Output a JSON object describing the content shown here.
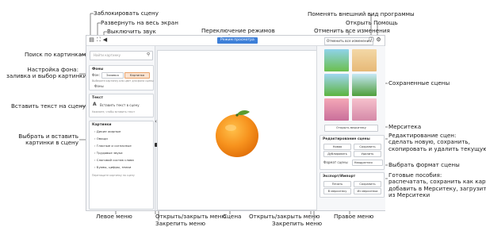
{
  "annotations": {
    "lock_scene": "Заблокировать сцену",
    "fullscreen": "Развернуть на весь экран",
    "mute": "Выключить звук",
    "mode_switch": "Переключение режимов",
    "change_look": "Поменять внешний вид программы",
    "open_help": "Открыть Помощь",
    "undo_all": "Отменить все изменения",
    "image_search": "Поиск по картинкам",
    "bg_setup": "Настройка фона:\nзаливка и выбор картинки",
    "insert_text": "Вставить текст на сцену",
    "insert_images": "Выбрать и вставить\nкартинки в сцену",
    "saved_scenes": "Сохраненные сцены",
    "merstika": "Мерситека",
    "edit_scenes": "Редактирование сцен:\nсделать новую, сохранить,\nскопировать и удалить текущую сцену",
    "scene_format": "Выбрать формат сцены",
    "ready_tools": "Готовые пособия:\nраспечатать, сохранить как картинку,\nдобавить в Мерситеку, загрузить\nиз Мерситеки",
    "left_menu": "Левое меню",
    "toggle_menu_left": "Открыть/закрыть меню",
    "pin_menu_left": "Закрепить меню",
    "scene": "Сцена",
    "toggle_menu_right": "Открыть/закрыть меню",
    "pin_menu_right": "Закрепить меню",
    "right_menu": "Правое меню"
  },
  "app": {
    "mode_button": "Режим просмотра",
    "reset_button": "Отменить все изменения",
    "left": {
      "search_placeholder": "Найти картинку",
      "bg_title": "Фоны",
      "bg_label": "Фон:",
      "bg_fill": "Заливка",
      "bg_picture": "Картинка",
      "bg_hint": "Выберите картинку или цвет для фона сцены",
      "bg_link": "Фоны",
      "text_title": "Текст",
      "text_button": "Вставить текст в сцену",
      "text_hint": "Нажмите, чтобы вставить текст",
      "images_title": "Картинки",
      "categories": [
        "Дикие жирные",
        "Овощи",
        "Гласные и согласные",
        "Трудовые звуки",
        "Слоговой состав слова",
        "Буквы, цифры, знаки"
      ],
      "images_hint": "Перетащите картинку на сцену"
    },
    "right": {
      "merstika_button": "Открыть мерситеку",
      "edit_title": "Редактирование сцены",
      "edit_new": "Новая",
      "edit_save": "Сохранить",
      "edit_copy": "Дублировать",
      "edit_delete": "Удалить",
      "format_label": "Формат сцены",
      "format_value": "Квадратная",
      "ready_title": "Экспорт/Импорт",
      "print": "Печать",
      "save_img": "Сохранить",
      "add_merstika": "В мерситеку",
      "load_merstika": "Из мерситеки"
    }
  },
  "colors": {
    "accent": "#3d7fd8",
    "orange": "#f7931e",
    "leaf": "#5a9a2f"
  }
}
